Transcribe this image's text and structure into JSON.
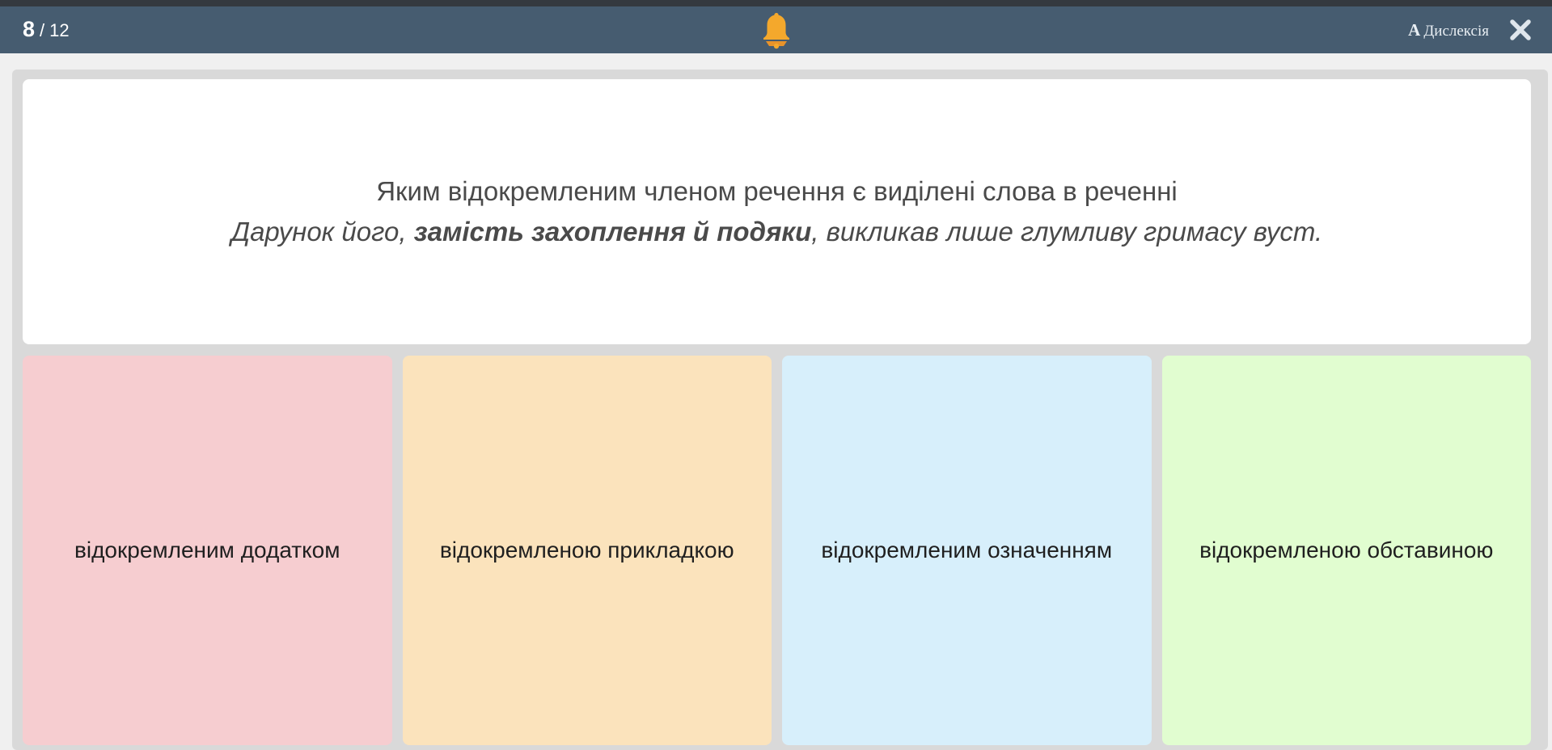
{
  "header": {
    "counter_current": "8",
    "counter_separator": "/",
    "counter_total": "12",
    "bell_icon": "bell-icon",
    "dyslexia_glyph": "A",
    "dyslexia_label": "Дислексія",
    "close_icon": "close-icon"
  },
  "question": {
    "line1": "Яким відокремленим членом речення є виділені слова в реченні",
    "line2_before": "Дарунок його, ",
    "line2_bold": "замість захоплення й подяки",
    "line2_after": ", викликав лише глумливу гримасу вуст."
  },
  "answers": [
    {
      "label": "відокремленим додатком",
      "color": "#f6cdd0"
    },
    {
      "label": "відокремленою прикладкою",
      "color": "#fbe3bc"
    },
    {
      "label": "відокремленим означенням",
      "color": "#d7effb"
    },
    {
      "label": "відокремленою обставиною",
      "color": "#e1fdd0"
    }
  ],
  "colors": {
    "topbar": "#465c70",
    "bell": "#f4a82c",
    "stage": "#d9d9d9"
  }
}
